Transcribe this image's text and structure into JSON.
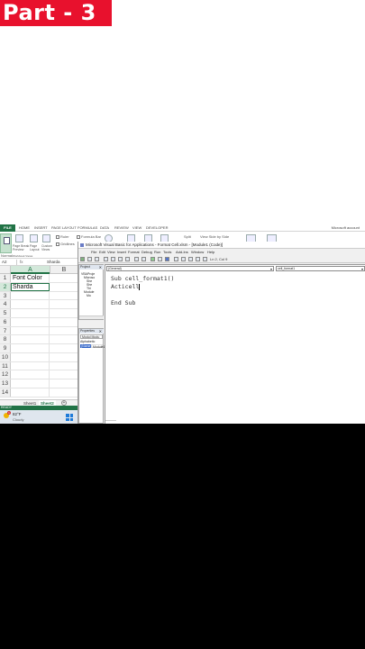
{
  "banner": {
    "title": "Part - 3"
  },
  "ribbon": {
    "file_tab": "FILE",
    "tabs": [
      "HOME",
      "INSERT",
      "PAGE LAYOUT",
      "FORMULAS",
      "DATA",
      "REVIEW",
      "VIEW",
      "DEVELOPER"
    ],
    "account": "Microsoft account",
    "view_group": {
      "normal": "Normal",
      "page_break": "Page Break Preview",
      "page_layout": "Page Layout",
      "custom_views": "Custom Views",
      "workbook_views": "Workbook Views",
      "ruler": "Ruler",
      "formula_bar": "Formula Bar",
      "gridlines": "Gridlines",
      "split": "Split",
      "hide": "Hide",
      "view_side_by_side": "View Side by Side",
      "synchronous_scrolling": "Synchronous Scrolling"
    }
  },
  "formula_bar": {
    "name_box": "A2",
    "fx": "fx",
    "value": "Sharda"
  },
  "sheet": {
    "columns": [
      "A",
      "B"
    ],
    "rows": [
      {
        "n": "1",
        "a": "Font Color"
      },
      {
        "n": "2",
        "a": "Sharda"
      },
      {
        "n": "3",
        "a": ""
      },
      {
        "n": "4",
        "a": ""
      },
      {
        "n": "5",
        "a": ""
      },
      {
        "n": "6",
        "a": ""
      },
      {
        "n": "7",
        "a": ""
      },
      {
        "n": "8",
        "a": ""
      },
      {
        "n": "9",
        "a": ""
      },
      {
        "n": "10",
        "a": ""
      },
      {
        "n": "11",
        "a": ""
      },
      {
        "n": "12",
        "a": ""
      },
      {
        "n": "13",
        "a": ""
      },
      {
        "n": "14",
        "a": ""
      }
    ],
    "tabs": [
      "Sheet1",
      "Sheet2"
    ],
    "active_tab": "Sheet2"
  },
  "status": {
    "text": "READY"
  },
  "taskbar": {
    "badge": "1",
    "temp": "82°F",
    "condition": "Cloudy"
  },
  "vbe": {
    "title": "Microsoft Visual Basic for Applications - Format Cell.xlsm - [Module1 (Code)]",
    "menu": [
      "File",
      "Edit",
      "View",
      "Insert",
      "Format",
      "Debug",
      "Run",
      "Tools",
      "Add-Ins",
      "Window",
      "Help"
    ],
    "cursor_pos": "Ln 2, Col 9",
    "project": {
      "header": "Project",
      "items": [
        "VBAProje",
        "Microso",
        "She",
        "She",
        "Thi",
        "Module",
        "Mo"
      ]
    },
    "properties": {
      "header": "Properties",
      "combo": "Modul Modu",
      "tabs": "Alphabetic",
      "name_key": "(Name)",
      "name_val": "Module1"
    },
    "code": {
      "object_combo": "(General)",
      "proc_combo": "cell_format1",
      "lines": [
        "Sub cell_format1()",
        "Acticell",
        "",
        "End Sub"
      ]
    }
  },
  "colors": {
    "excel_green": "#217346",
    "banner_red": "#e8112d",
    "selection_blue": "#2f63c7"
  }
}
